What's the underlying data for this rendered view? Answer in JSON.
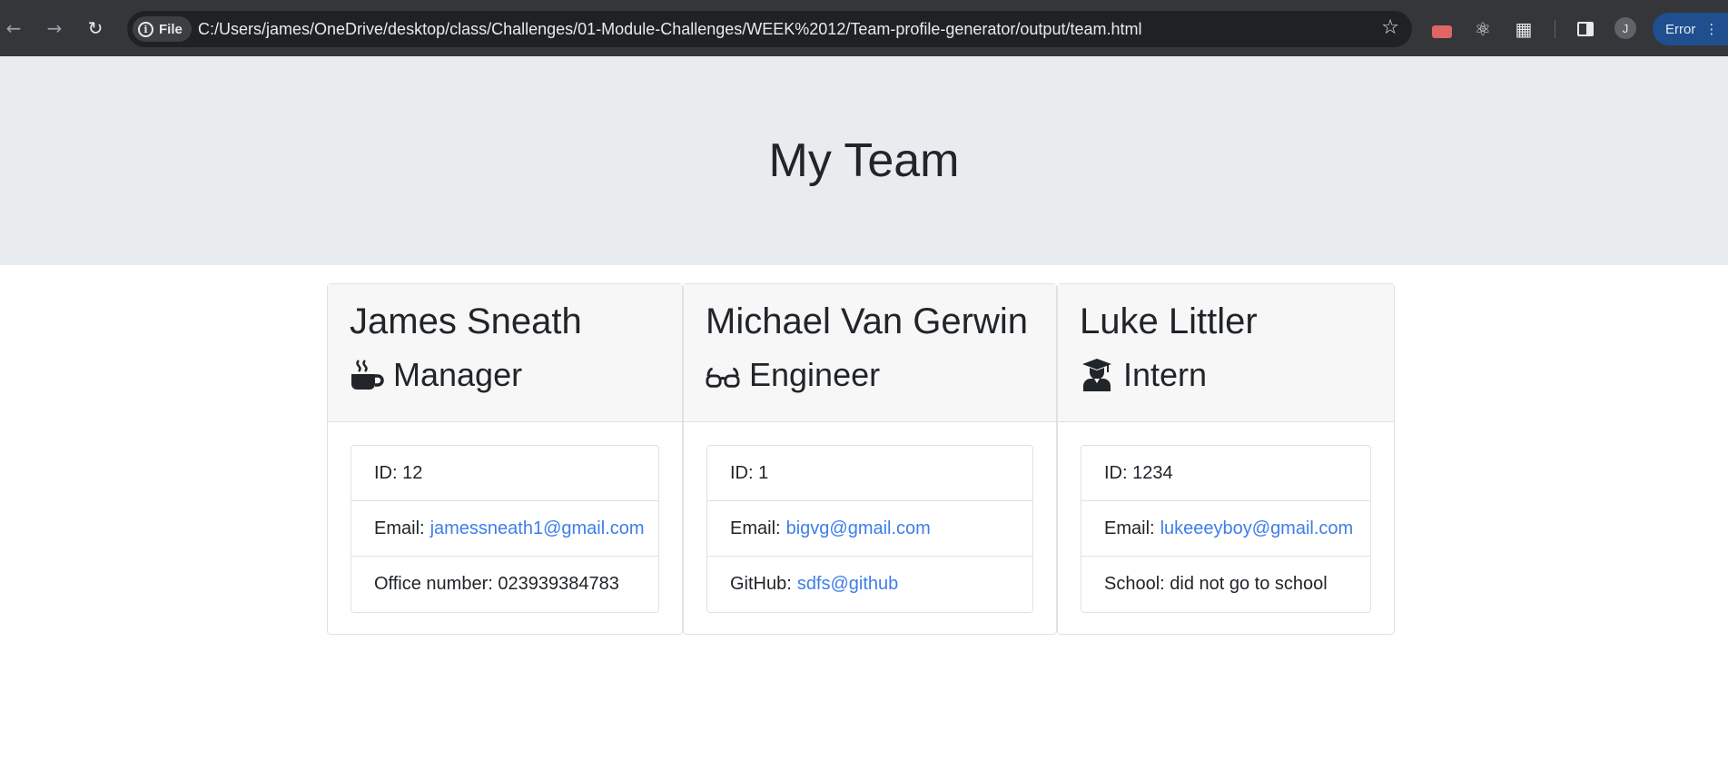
{
  "browser": {
    "file_label": "File",
    "url": "C:/Users/james/OneDrive/desktop/class/Challenges/01-Module-Challenges/WEEK%2012/Team-profile-generator/output/team.html",
    "avatar_initial": "J",
    "error_label": "Error"
  },
  "page": {
    "title": "My Team"
  },
  "team": [
    {
      "name": "James Sneath",
      "role": "Manager",
      "role_icon": "mug-icon",
      "id_label": "ID: 12",
      "email_prefix": "Email:",
      "email": "jamessneath1@gmail.com",
      "extra_label": "Office number: 023939384783"
    },
    {
      "name": "Michael Van Gerwin",
      "role": "Engineer",
      "role_icon": "glasses-icon",
      "id_label": "ID: 1",
      "email_prefix": "Email:",
      "email": "bigvg@gmail.com",
      "extra_prefix": "GitHub:",
      "extra_link": "sdfs@github"
    },
    {
      "name": "Luke Littler",
      "role": "Intern",
      "role_icon": "graduate-icon",
      "id_label": "ID: 1234",
      "email_prefix": "Email:",
      "email": "lukeeeyboy@gmail.com",
      "extra_label": "School: did not go to school"
    }
  ],
  "colors": {
    "link": "#3f7ee8",
    "jumbotron_bg": "#e9ecef",
    "card_header_bg": "#f7f7f7"
  }
}
